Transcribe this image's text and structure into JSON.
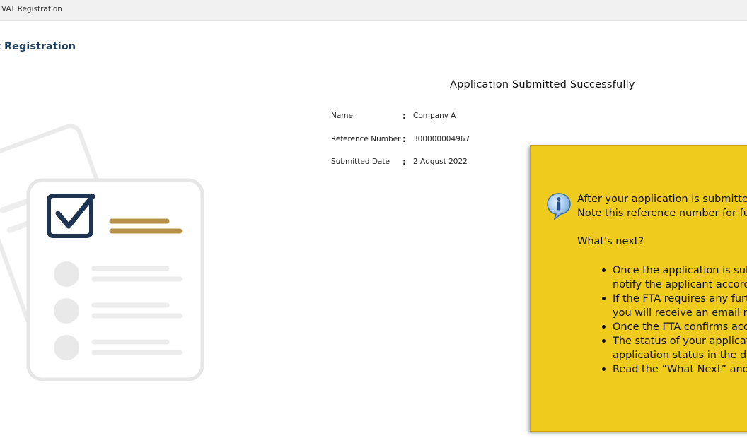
{
  "topbar": {
    "breadcrumb": "VAT Registration"
  },
  "page": {
    "title": "t Registration"
  },
  "success": {
    "title": "Application Submitted Successfully"
  },
  "details": [
    {
      "label": "Name",
      "value": "Company A"
    },
    {
      "label": "Reference Number",
      "value": "300000004967"
    },
    {
      "label": "Submitted Date",
      "value": "2 August 2022"
    }
  ],
  "tooltip": {
    "line1": "After your application is submitted",
    "line2": "Note this reference number for fut",
    "whats_next": "What's next?",
    "bullets": [
      "Once the application is sub",
      "notify the applicant accord",
      "If the FTA requires any furt",
      "you will receive an email no",
      "Once the FTA confirms acc",
      "The status of your applicat",
      "application status in the da",
      " Read the “What Next” and"
    ]
  },
  "colors": {
    "title": "#1f3f5f",
    "tooltip_bg": "#efcb1e",
    "accent_gold": "#b8904a",
    "icon_navy": "#1f3450"
  }
}
